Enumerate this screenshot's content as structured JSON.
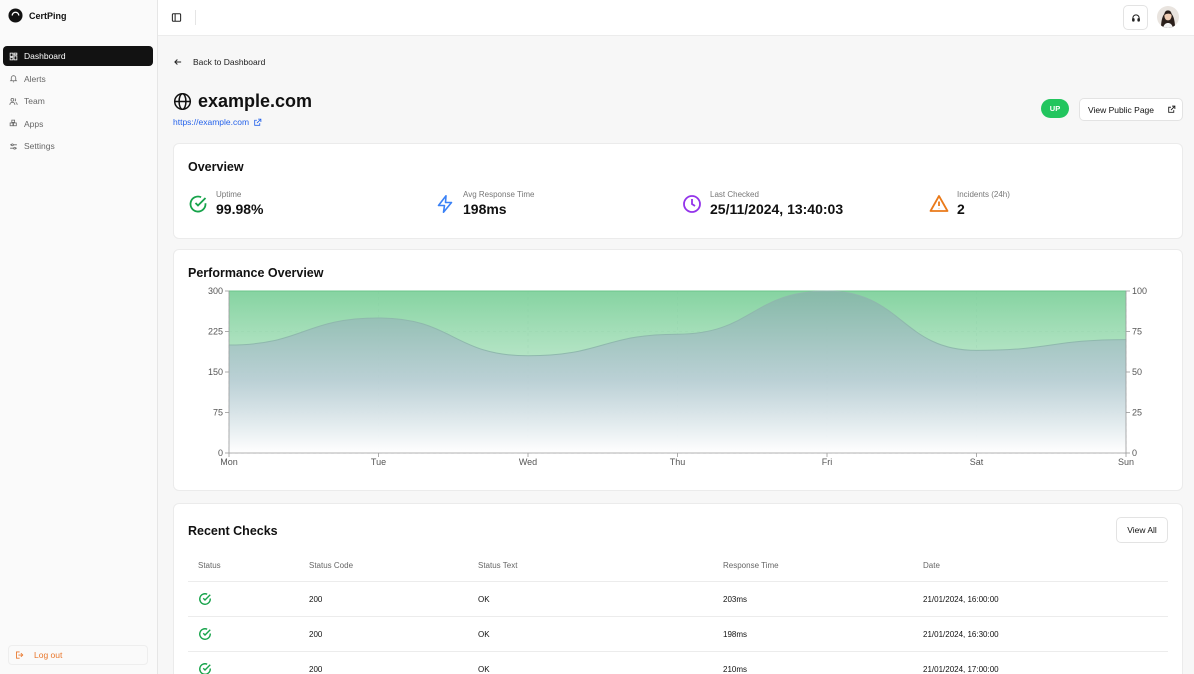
{
  "app": {
    "name": "CertPing"
  },
  "sidebar": {
    "items": [
      {
        "label": "Dashboard",
        "icon": "dashboard-icon",
        "active": true
      },
      {
        "label": "Alerts",
        "icon": "bell-icon"
      },
      {
        "label": "Team",
        "icon": "users-icon"
      },
      {
        "label": "Apps",
        "icon": "apps-icon"
      },
      {
        "label": "Settings",
        "icon": "sliders-icon"
      }
    ],
    "logout_label": "Log out"
  },
  "page": {
    "back_label": "Back to Dashboard",
    "site_title": "example.com",
    "site_url": "https://example.com",
    "status": "UP",
    "public_button": "View Public Page"
  },
  "overview": {
    "title": "Overview",
    "metrics": [
      {
        "label": "Uptime",
        "value": "99.98%",
        "icon": "check-circle-icon",
        "color": "#16a34a"
      },
      {
        "label": "Avg Response Time",
        "value": "198ms",
        "icon": "lightning-icon",
        "color": "#3b82f6"
      },
      {
        "label": "Last Checked",
        "value": "25/11/2024, 13:40:03",
        "icon": "clock-icon",
        "color": "#9333ea"
      },
      {
        "label": "Incidents (24h)",
        "value": "2",
        "icon": "warning-icon",
        "color": "#ea7a1a"
      }
    ]
  },
  "performance": {
    "title": "Performance Overview"
  },
  "chart_data": {
    "type": "area",
    "title": "Performance Overview",
    "categories": [
      "Mon",
      "Tue",
      "Wed",
      "Thu",
      "Fri",
      "Sat",
      "Sun"
    ],
    "series": [
      {
        "axis": "left",
        "values": [
          200,
          250,
          180,
          220,
          300,
          190,
          210
        ],
        "color": "#a7cdc8"
      },
      {
        "axis": "right",
        "values": [
          100,
          100,
          100,
          100,
          100,
          100,
          100
        ],
        "color": "#86d4a1"
      }
    ],
    "y_left": {
      "range": [
        0,
        300
      ],
      "ticks": [
        "0",
        "75",
        "150",
        "225",
        "300"
      ]
    },
    "y_right": {
      "range": [
        0,
        100
      ],
      "ticks": [
        "0",
        "25",
        "50",
        "75",
        "100"
      ]
    },
    "grid": true
  },
  "checks": {
    "title": "Recent Checks",
    "view_all": "View All",
    "columns": [
      "Status",
      "Status Code",
      "Status Text",
      "Response Time",
      "Date"
    ],
    "rows": [
      {
        "code": "200",
        "text": "OK",
        "time": "203ms",
        "date": "21/01/2024, 16:00:00"
      },
      {
        "code": "200",
        "text": "OK",
        "time": "198ms",
        "date": "21/01/2024, 16:30:00"
      },
      {
        "code": "200",
        "text": "OK",
        "time": "210ms",
        "date": "21/01/2024, 17:00:00"
      }
    ]
  }
}
